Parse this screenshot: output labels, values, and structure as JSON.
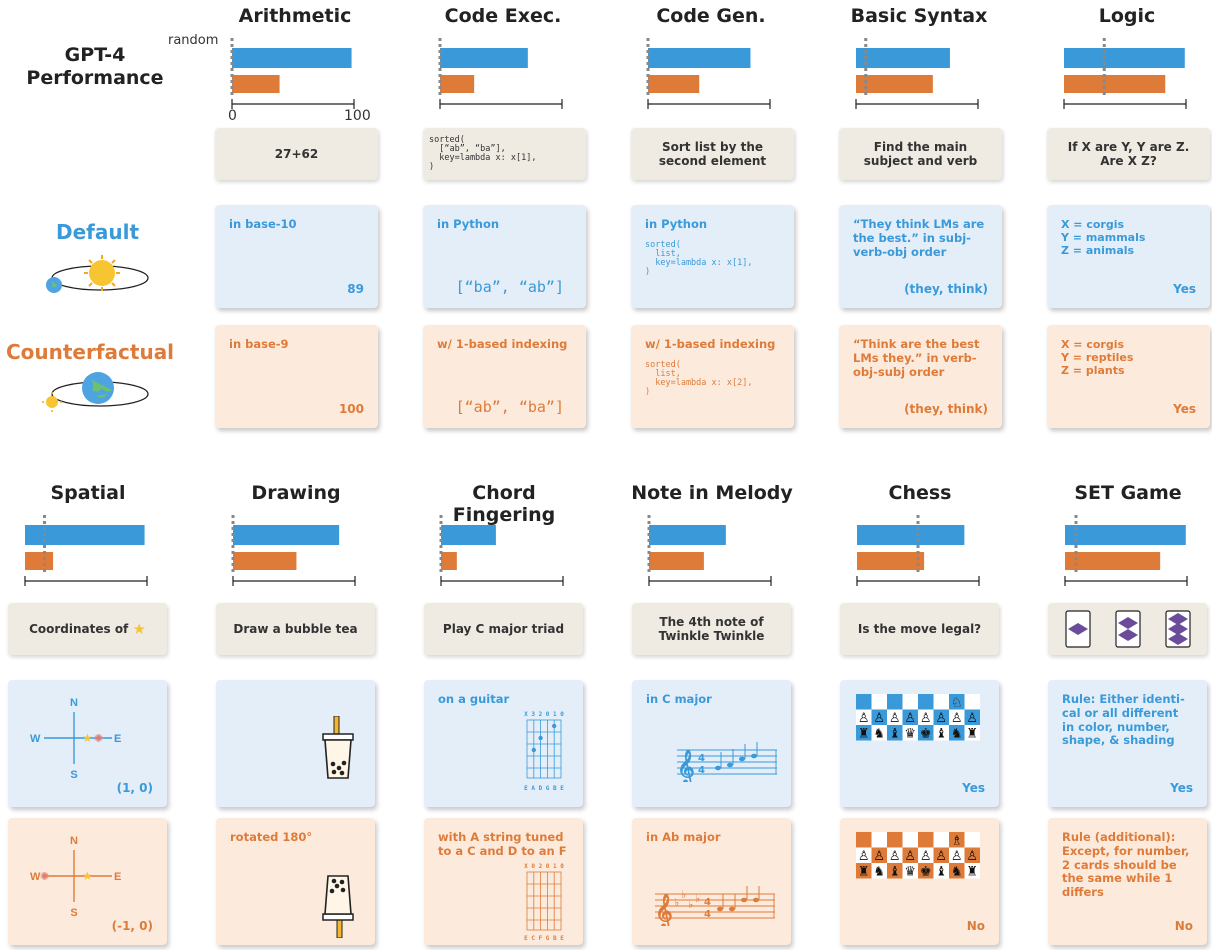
{
  "colors": {
    "default": "#3a9ad9",
    "counterfactual": "#df7b39",
    "task_bg": "#efebe3",
    "default_bg": "#e3eef9",
    "cf_bg": "#fcebdd"
  },
  "row_labels": {
    "gpt4": "GPT-4\nPerformance",
    "default": "Default",
    "counterfactual": "Counterfactual"
  },
  "axis": {
    "random_label": "random",
    "tick_min": "0",
    "tick_max": "100"
  },
  "chart_data": {
    "type": "bar",
    "xlim": [
      0,
      100
    ],
    "series": [],
    "panels": [
      {
        "title": "Arithmetic",
        "default": 98,
        "counterfactual": 39,
        "random": 0
      },
      {
        "title": "Code Exec.",
        "default": 72,
        "counterfactual": 28,
        "random": 0
      },
      {
        "title": "Code Gen.",
        "default": 84,
        "counterfactual": 42,
        "random": 0
      },
      {
        "title": "Basic Syntax",
        "default": 77,
        "counterfactual": 63,
        "random": 8
      },
      {
        "title": "Logic",
        "default": 99,
        "counterfactual": 83,
        "random": 33
      },
      {
        "title": "Spatial",
        "default": 98,
        "counterfactual": 23,
        "random": 16
      },
      {
        "title": "Drawing",
        "default": 87,
        "counterfactual": 52,
        "random": 0
      },
      {
        "title": "Chord Fingering",
        "default": 45,
        "counterfactual": 13,
        "random": 0
      },
      {
        "title": "Note in Melody",
        "default": 63,
        "counterfactual": 45,
        "random": 0
      },
      {
        "title": "Chess",
        "default": 88,
        "counterfactual": 55,
        "random": 50
      },
      {
        "title": "SET Game",
        "default": 99,
        "counterfactual": 78,
        "random": 9
      }
    ]
  },
  "row1": [
    {
      "task": "27+62",
      "task_code": false,
      "def_head": "in base-10",
      "def_ans": "89",
      "cf_head": "in base-9",
      "cf_ans": "100"
    },
    {
      "task": "sorted(\n  [“ab”, “ba”],\n  key=lambda x: x[1],\n)",
      "task_code": true,
      "def_head": "in Python",
      "def_ans": "[“ba”, “ab”]",
      "cf_head": "w/ 1-based indexing",
      "cf_ans": "[“ab”, “ba”]"
    },
    {
      "task": "Sort list by the second element",
      "task_code": false,
      "def_head": "in Python",
      "def_code": "sorted(\n  list,\n  key=lambda x: x[1],\n)",
      "cf_head": "w/ 1-based indexing",
      "cf_code": "sorted(\n  list,\n  key=lambda x: x[2],\n)"
    },
    {
      "task": "Find the main subject and verb",
      "task_code": false,
      "def_head": "“They think LMs are the best.” in subj-verb-obj order",
      "def_ans": "(they, think)",
      "cf_head": "“Think are the best LMs they.” in verb-obj-subj order",
      "cf_ans": "(they, think)"
    },
    {
      "task": "If X are Y, Y are Z. Are X Z?",
      "task_code": false,
      "def_head": "X = corgis\nY = mammals\nZ = animals",
      "def_ans": "Yes",
      "cf_head": "X = corgis\nY = reptiles\nZ = plants",
      "cf_ans": "Yes"
    }
  ],
  "row2": [
    {
      "task": "Coordinates of",
      "def_head": "",
      "def_ans": "(1, 0)",
      "cf_head": "",
      "cf_ans": "(-1, 0)",
      "compass": {
        "n": "N",
        "s": "S",
        "w": "W",
        "e": "E"
      }
    },
    {
      "task": "Draw a bubble tea",
      "def_head": "",
      "def_ans": "",
      "cf_head": "rotated 180°",
      "cf_ans": ""
    },
    {
      "task": "Play C major triad",
      "def_head": "on a guitar",
      "def_ans": "",
      "cf_head": "with A string tuned to a C and D to an F",
      "cf_ans": "",
      "def_strings": "E A D G B E",
      "def_frets": "X 3 2 0 1 0",
      "cf_strings": "E C F G B E",
      "cf_frets": "X 0 2 0 1 0"
    },
    {
      "task": "The 4th note of Twinkle Twinkle",
      "def_head": "in C major",
      "def_ans": "",
      "cf_head": "in Ab major",
      "cf_ans": ""
    },
    {
      "task": "Is the move legal?",
      "def_head": "",
      "def_ans": "Yes",
      "cf_head": "",
      "cf_ans": "No"
    },
    {
      "task": "",
      "def_head": "Rule: Either identi-cal or all different in color, number, shape, & shading",
      "def_ans": "Yes",
      "cf_head": "Rule (additional): Except, for number, 2 cards should be the same while 1 differs",
      "cf_ans": "No"
    }
  ]
}
